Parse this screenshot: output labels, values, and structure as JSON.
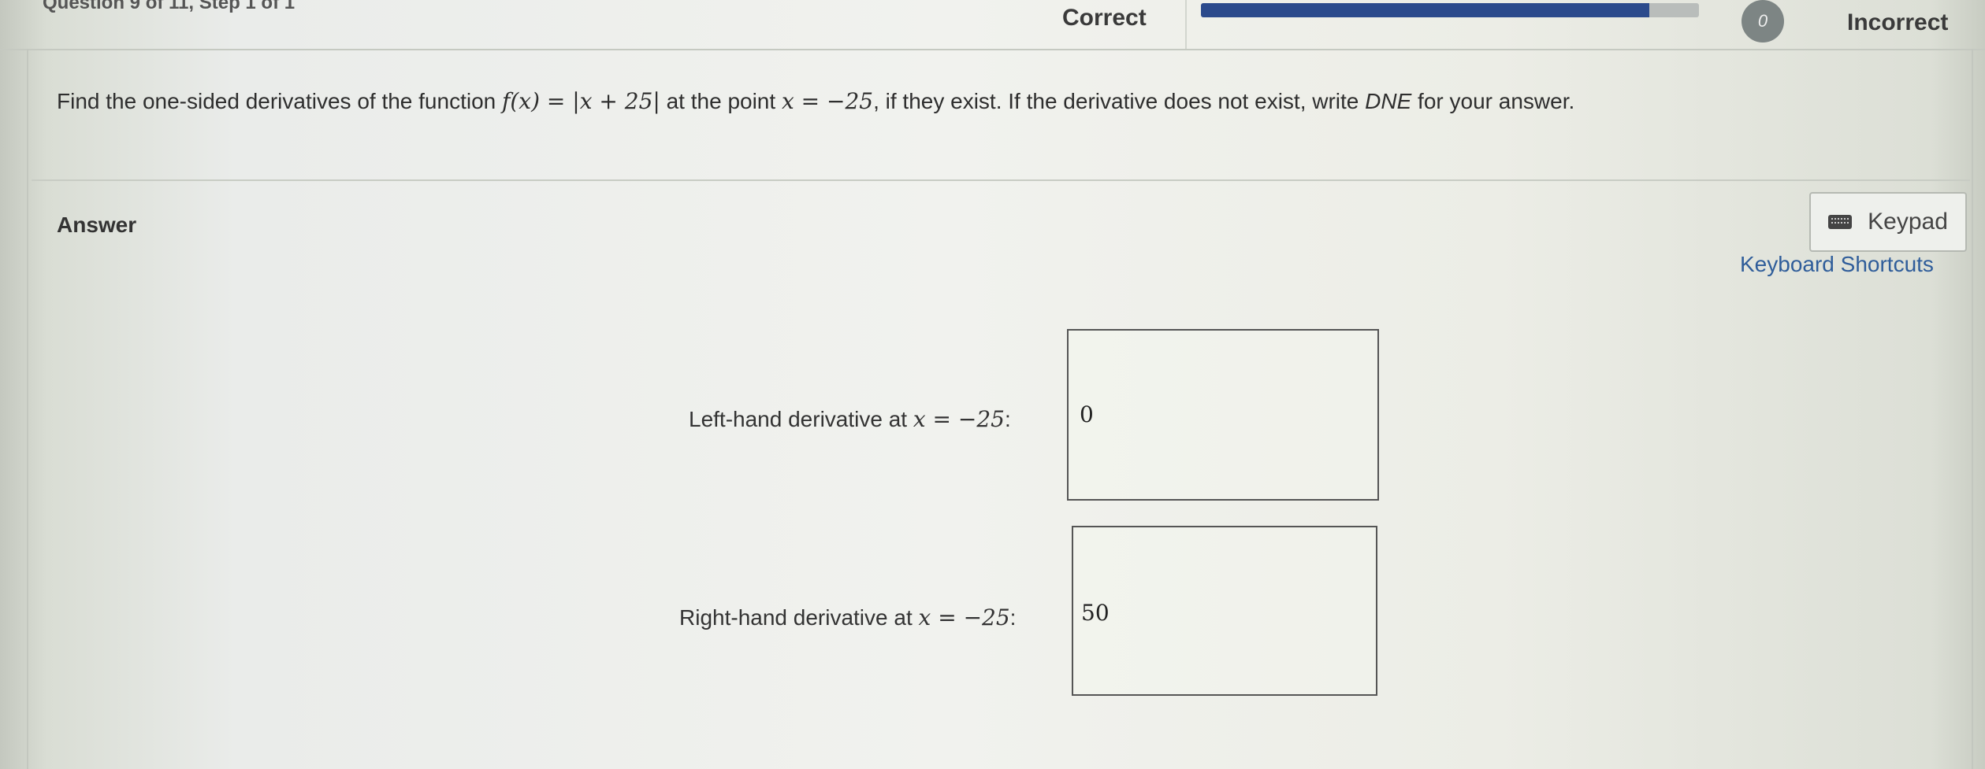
{
  "header": {
    "question_counter": "Question 9 of 11, Step 1 of 1",
    "correct_label": "Correct",
    "incorrect_label": "Incorrect",
    "progress_fraction": 0.9,
    "score_badge": "0"
  },
  "question": {
    "text_before": "Find the one-sided derivatives of the function ",
    "function": "f(x) = |x + 25|",
    "text_middle": " at the point ",
    "point": "x = −25",
    "text_after": ", if they exist. If the derivative does not exist, write ",
    "dne": "DNE",
    "text_end": " for your answer."
  },
  "answer": {
    "heading": "Answer",
    "keypad_label": "Keypad",
    "keyboard_shortcuts_label": "Keyboard Shortcuts",
    "left": {
      "label": "Left-hand derivative at ",
      "point": "x = −25",
      "colon": ":",
      "value": "0"
    },
    "right": {
      "label": "Right-hand derivative at ",
      "point": "x = −25",
      "colon": ":",
      "value": "50"
    }
  },
  "colors": {
    "progress_fill": "#2b4a8c",
    "link": "#2f5d9a"
  }
}
